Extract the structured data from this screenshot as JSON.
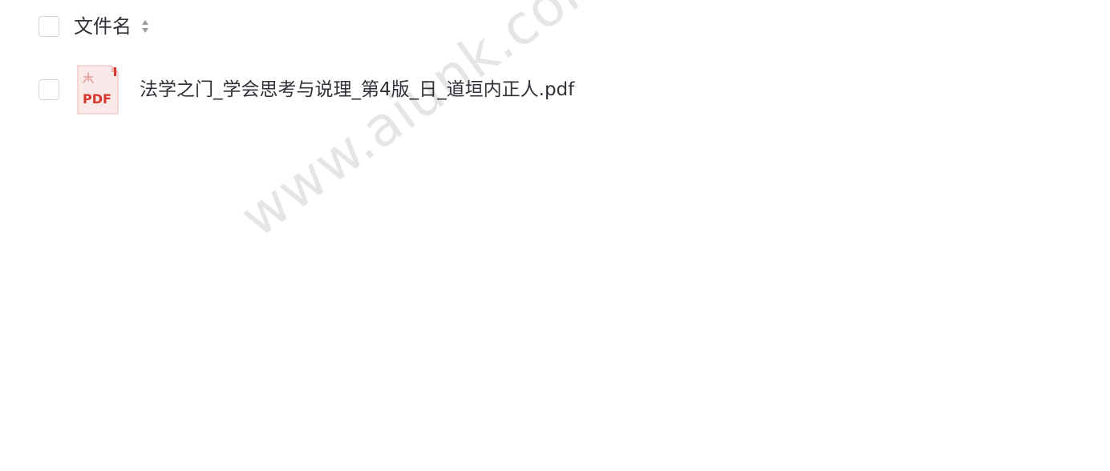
{
  "file_list": {
    "header": {
      "name_column_label": "文件名",
      "sort_icon": "sort-updown-icon"
    },
    "rows": [
      {
        "name": "法学之门_学会思考与说理_第4版_日_道垣内正人.pdf",
        "file_type_icon": "pdf-file-icon",
        "icon_text": "PDF"
      }
    ]
  },
  "watermark": {
    "text": "www.aiunk.com"
  },
  "colors": {
    "text": "#303238",
    "checkbox_border": "#d5d5d8",
    "pdf_red": "#d9362f",
    "pdf_light": "#f9e9e8",
    "watermark": "#e5e5e5"
  }
}
